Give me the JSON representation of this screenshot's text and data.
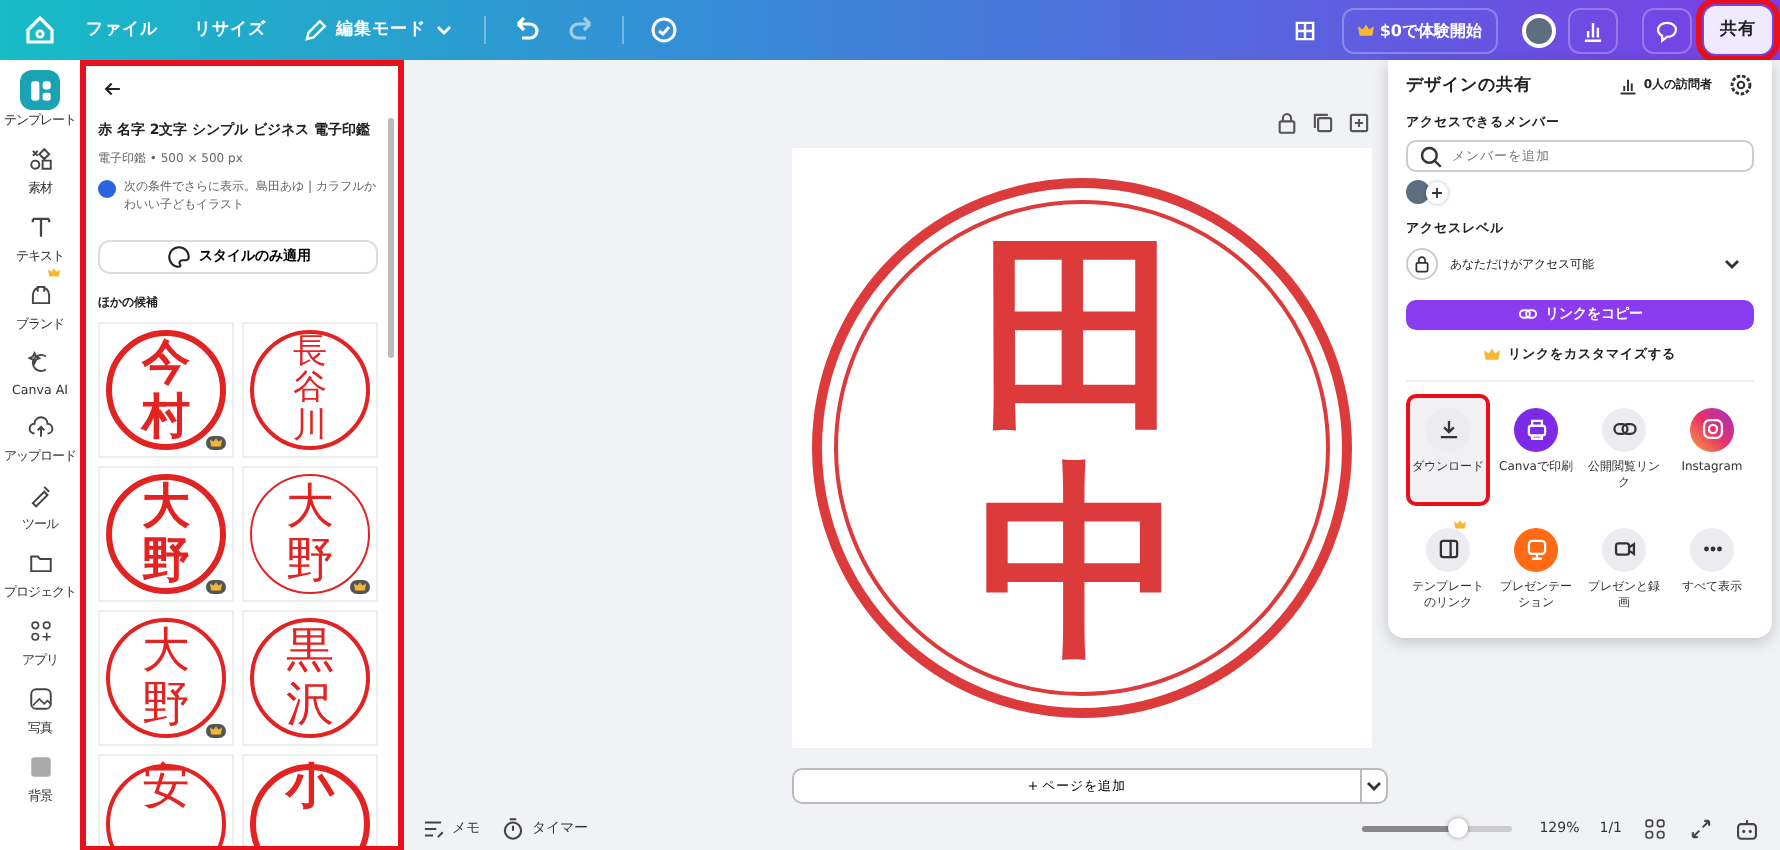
{
  "topbar": {
    "menu": [
      {
        "label": "ファイル"
      },
      {
        "label": "リサイズ"
      }
    ],
    "mode": "編集モード",
    "trial": "$0で体験開始",
    "share": {
      "label": "共有",
      "highlighted": true
    }
  },
  "rail": [
    {
      "label": "テンプレート",
      "selected": true,
      "premium": false
    },
    {
      "label": "素材",
      "selected": false,
      "premium": false
    },
    {
      "label": "テキスト",
      "selected": false,
      "premium": false
    },
    {
      "label": "ブランド",
      "selected": false,
      "premium": true
    },
    {
      "label": "Canva AI",
      "selected": false,
      "premium": false
    },
    {
      "label": "アップロード",
      "selected": false,
      "premium": false
    },
    {
      "label": "ツール",
      "selected": false,
      "premium": false
    },
    {
      "label": "プロジェクト",
      "selected": false,
      "premium": false
    },
    {
      "label": "アプリ",
      "selected": false,
      "premium": false
    },
    {
      "label": "写真",
      "selected": false,
      "premium": false
    },
    {
      "label": "背景",
      "selected": false,
      "premium": false
    }
  ],
  "panel": {
    "highlighted": true,
    "title": "赤 名字 2文字 シンプル ビジネス 電子印鑑",
    "meta": "電子印鑑 • 500 × 500 px",
    "credit": "次の条件でさらに表示。島田あゆ | カラフルかわいい子どもイラスト",
    "style_button": "スタイルのみ適用",
    "section": "ほかの候補",
    "thumbs": [
      {
        "text": "今村",
        "kind": "heavy",
        "premium": true
      },
      {
        "text": "長谷川",
        "kind": "regular",
        "premium": false
      },
      {
        "text": "大野",
        "kind": "heavy",
        "premium": true
      },
      {
        "text": "大野",
        "kind": "thin",
        "premium": true
      },
      {
        "text": "大野",
        "kind": "regular",
        "premium": true
      },
      {
        "text": "黒沢",
        "kind": "regular",
        "premium": false
      },
      {
        "text": "安",
        "kind": "regular",
        "premium": false
      },
      {
        "text": "小",
        "kind": "heavy",
        "premium": false
      }
    ]
  },
  "canvas": {
    "stamp": {
      "text": "田中"
    },
    "add_page": "+ ページを追加"
  },
  "bottom": {
    "notes": "メモ",
    "timer": "タイマー",
    "zoom": {
      "level": 0.65,
      "reading": "129%"
    },
    "pages": "1/1"
  },
  "share": {
    "title": "デザインの共有",
    "visitors": "0人の訪問者",
    "members_label": "アクセスできるメンバー",
    "member_search": {
      "placeholder": "メンバーを追加"
    },
    "access_label": "アクセスレベル",
    "access_value": "あなただけがアクセス可能",
    "copy_link": "リンクをコピー",
    "customize": "リンクをカスタマイズする",
    "actions": [
      {
        "label": "ダウンロード",
        "kind": "download",
        "highlighted": true,
        "premium": false
      },
      {
        "label": "Canvaで印刷",
        "kind": "print",
        "highlighted": false,
        "premium": false
      },
      {
        "label": "公開閲覧リンク",
        "kind": "link",
        "highlighted": false,
        "premium": false
      },
      {
        "label": "Instagram",
        "kind": "instagram",
        "highlighted": false,
        "premium": false
      },
      {
        "label": "テンプレートのリンク",
        "kind": "template",
        "highlighted": false,
        "premium": true
      },
      {
        "label": "プレゼンテーション",
        "kind": "present",
        "highlighted": false,
        "premium": false
      },
      {
        "label": "プレゼンと録画",
        "kind": "record",
        "highlighted": false,
        "premium": false
      },
      {
        "label": "すべて表示",
        "kind": "more",
        "highlighted": false,
        "premium": false
      }
    ]
  }
}
